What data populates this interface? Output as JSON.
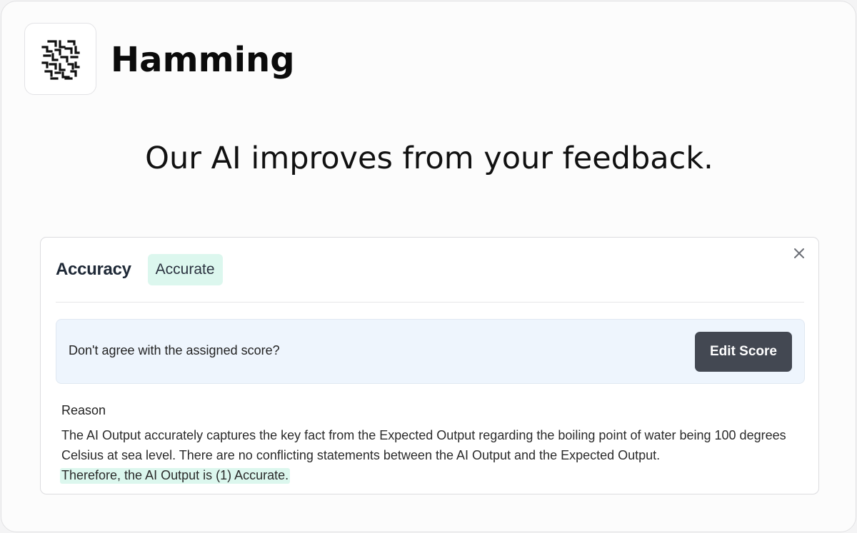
{
  "brand": {
    "logo_icon": "hamming-maze-logo-icon",
    "name": "Hamming"
  },
  "headline": "Our AI improves from your feedback.",
  "card": {
    "close_icon": "close-icon",
    "metric_label": "Accuracy",
    "badge": "Accurate",
    "feedback_prompt": "Don't agree with the assigned score?",
    "edit_button": "Edit Score",
    "reason_title": "Reason",
    "reason_text": "The AI Output accurately captures the key fact from the Expected Output regarding the boiling point of water being 100 degrees Celsius at sea level. There are no conflicting statements between the AI Output and the Expected Output.",
    "reason_highlight": "Therefore, the AI Output is (1) Accurate."
  },
  "colors": {
    "badge_bg": "#dcf7ee",
    "feedback_bg": "#eef5fd",
    "button_bg": "#434852"
  }
}
